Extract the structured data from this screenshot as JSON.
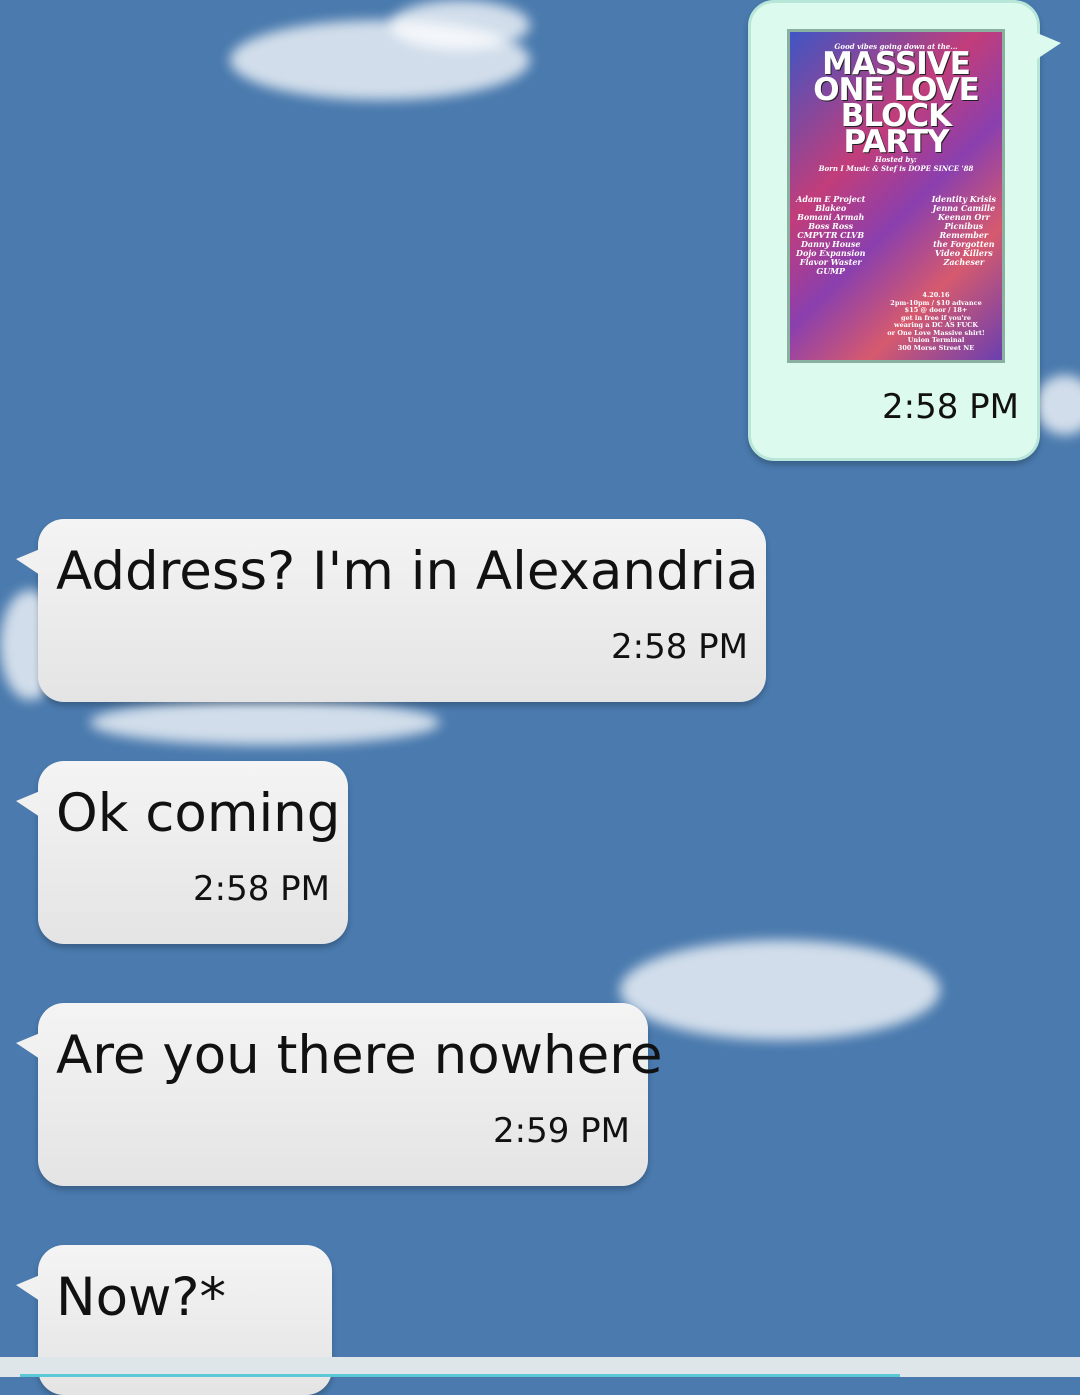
{
  "messages": [
    {
      "id": "m0",
      "direction": "outgoing",
      "type": "image",
      "time": "2:58 PM"
    },
    {
      "id": "m1",
      "direction": "incoming",
      "text": "Address? I'm in Alexandria",
      "time": "2:58 PM"
    },
    {
      "id": "m2",
      "direction": "incoming",
      "text": "Ok coming",
      "time": "2:58 PM"
    },
    {
      "id": "m3",
      "direction": "incoming",
      "text": "Are you there nowhere",
      "time": "2:59 PM"
    },
    {
      "id": "m4",
      "direction": "incoming",
      "text": "Now?*",
      "time": ""
    }
  ],
  "poster": {
    "tagline": "Good vibes going down at the...",
    "title_line1": "MASSIVE",
    "title_line2": "ONE LOVE",
    "title_line3": "BLOCK PARTY",
    "heart_text": "one",
    "hosted_by": "Hosted by:",
    "hosts": "Born I Music & Stef is DOPE SINCE '88",
    "lineup_left": [
      "Adam E Project",
      "Blakeo",
      "Bomani Armah",
      "Boss Ross",
      "CMPVTR CLVB",
      "Danny House",
      "Dojo Expansion",
      "Flavor Waster",
      "GUMP"
    ],
    "lineup_right": [
      "Identity Krisis",
      "Jenna Camille",
      "Keenan Orr",
      "Picnibus",
      "Remember",
      "the Forgotten",
      "Video Killers",
      "Zacheser"
    ],
    "event_info": [
      "4.20.16",
      "2pm-10pm / $10 advance",
      "$15 @ door / 18+",
      "get in free if you're",
      "wearing a DC AS FUCK",
      "or One Love Massive shirt!",
      "Union Terminal",
      "300 Morse Street NE"
    ]
  },
  "colors": {
    "background": "#4a7aae",
    "incoming_bubble": "#ececec",
    "outgoing_bubble": "#dcfaee"
  }
}
